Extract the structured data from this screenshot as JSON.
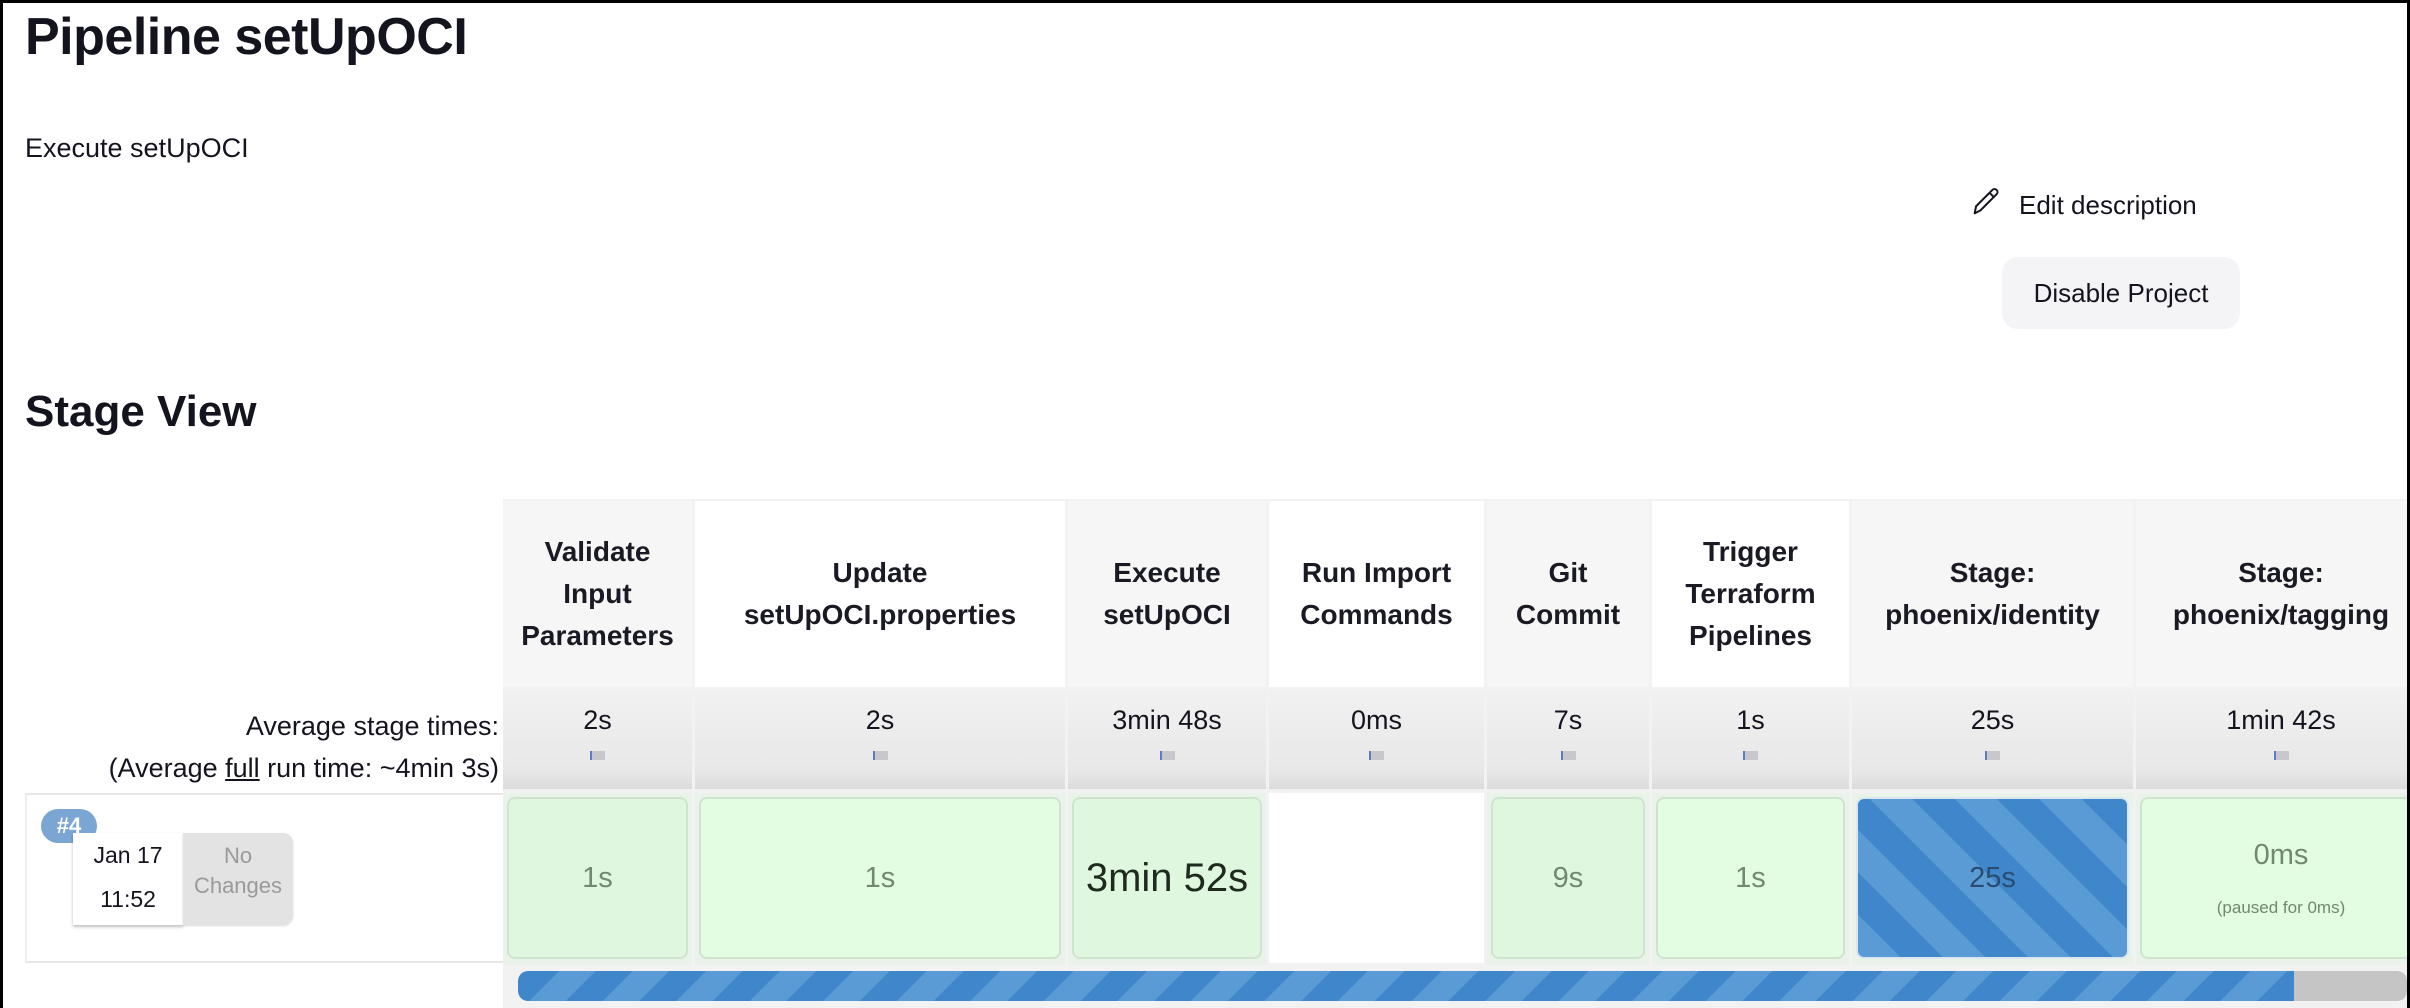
{
  "page": {
    "title": "Pipeline setUpOCI",
    "description": "Execute setUpOCI",
    "edit_description_label": "Edit description",
    "edit_icon": "pencil-icon",
    "disable_button_label": "Disable Project",
    "stage_view_title": "Stage View"
  },
  "stage_view": {
    "avg_label_line1": "Average stage times:",
    "avg_label_prefix": "(Average ",
    "avg_label_link": "full",
    "avg_label_suffix": " run time: ~4min 3s)",
    "stages": [
      {
        "name_lines": [
          "Validate",
          "Input",
          "Parameters"
        ],
        "avg": "2s"
      },
      {
        "name_lines": [
          "Update",
          "setUpOCI.properties"
        ],
        "avg": "2s"
      },
      {
        "name_lines": [
          "Execute",
          "setUpOCI"
        ],
        "avg": "3min 48s"
      },
      {
        "name_lines": [
          "Run Import",
          "Commands"
        ],
        "avg": "0ms"
      },
      {
        "name_lines": [
          "Git",
          "Commit"
        ],
        "avg": "7s"
      },
      {
        "name_lines": [
          "Trigger",
          "Terraform",
          "Pipelines"
        ],
        "avg": "1s"
      },
      {
        "name_lines": [
          "Stage:",
          "phoenix/identity"
        ],
        "avg": "25s"
      },
      {
        "name_lines": [
          "Stage:",
          "phoenix/tagging"
        ],
        "avg": "1min 42s"
      }
    ],
    "runs": [
      {
        "number": "#4",
        "date": "Jan 17",
        "time": "11:52",
        "changes": "No Changes",
        "cells": [
          {
            "value": "1s",
            "status": "success"
          },
          {
            "value": "1s",
            "status": "success"
          },
          {
            "value": "3min 52s",
            "status": "success"
          },
          {
            "value": "",
            "status": "not-executed"
          },
          {
            "value": "9s",
            "status": "success"
          },
          {
            "value": "1s",
            "status": "success"
          },
          {
            "value": "25s",
            "status": "in-progress"
          },
          {
            "value": "0ms",
            "sub": "(paused for 0ms)",
            "status": "success"
          }
        ],
        "progress_percent": 94
      }
    ]
  }
}
